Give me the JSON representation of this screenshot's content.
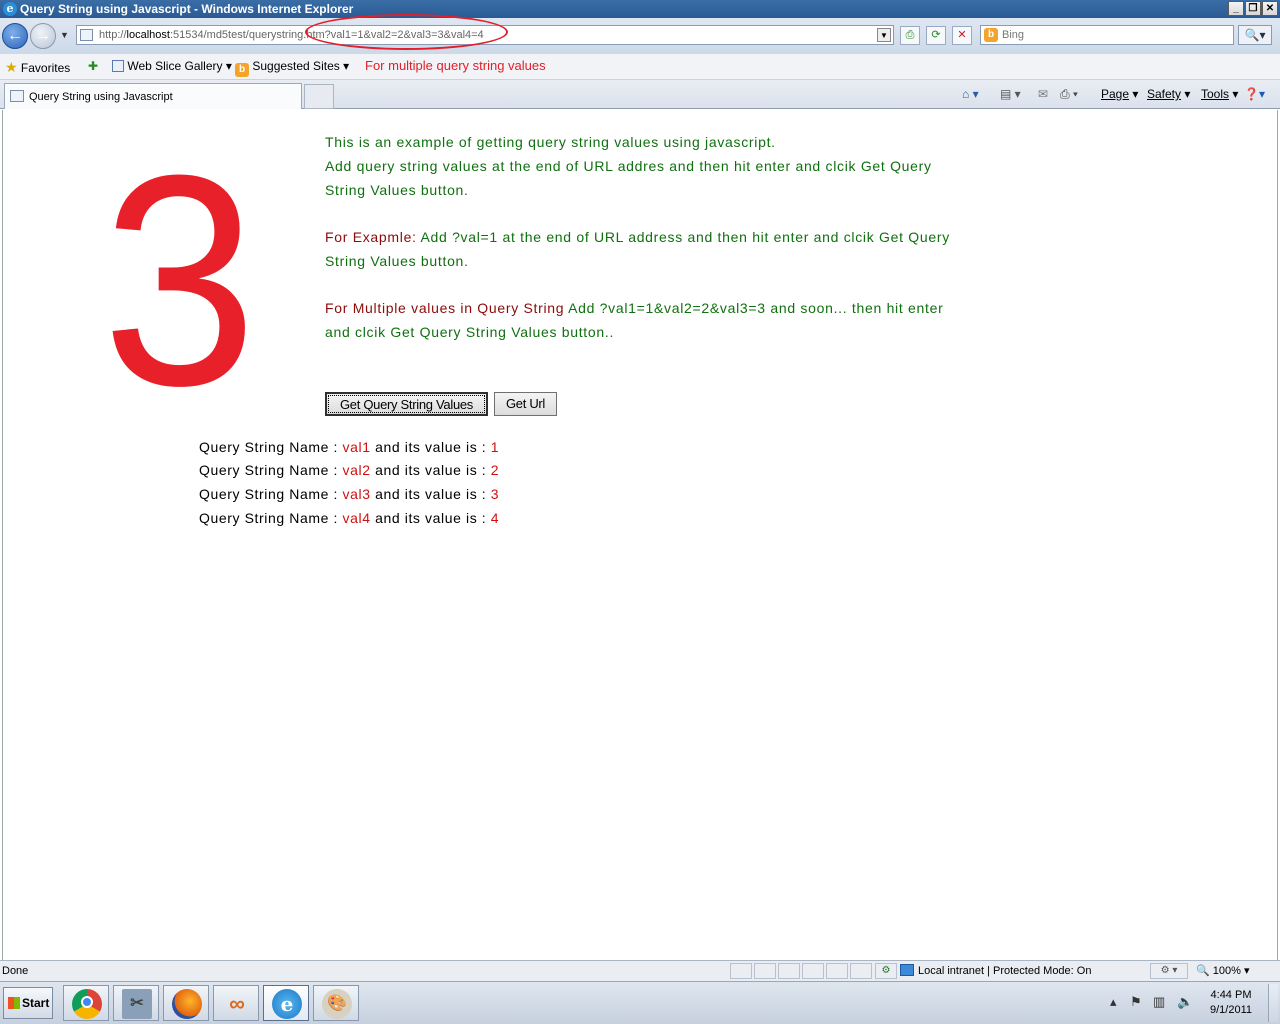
{
  "window": {
    "title": "Query String using Javascript - Windows Internet Explorer",
    "app_icon": "ie-icon"
  },
  "address_bar": {
    "url_prefix": "http://",
    "url_host": "localhost",
    "url_path": ":51534/md5test/querystring",
    "url_query": ".htm?val1=1&val2=2&val3=3&val4=4",
    "search_placeholder": "Bing"
  },
  "favorites_bar": {
    "favorites_label": "Favorites",
    "web_slice_gallery": "Web Slice Gallery ▾",
    "suggested_sites": "Suggested Sites ▾",
    "annotation": "For multiple query string values"
  },
  "tab_bar": {
    "active_tab": "Query String using Javascript",
    "commands": {
      "page": "Page",
      "safety": "Safety",
      "tools": "Tools"
    }
  },
  "content": {
    "big_number": "3",
    "intro_line1": "This is an example of getting query string values using javascript.",
    "intro_line2": "Add query string values at the end of URL addres and then hit enter and clcik Get Query String Values button.",
    "example_label": "For Exapmle:",
    "example_text": " Add ?val=1 at the end of URL address and then hit enter and clcik Get Query String Values button.",
    "multiple_label_a": "For Multiple values in ",
    "multiple_label_b": "Query String",
    "multiple_text": " Add ?val1=1&val2=2&val3=3 and soon... then hit enter and clcik Get Query String Values button..",
    "buttons": {
      "get_values": "Get Query String Values",
      "get_url": "Get Url"
    },
    "result_prefix": "Query String Name : ",
    "result_middle": " and its value is : ",
    "results": [
      {
        "name": "val1",
        "value": "1"
      },
      {
        "name": "val2",
        "value": "2"
      },
      {
        "name": "val3",
        "value": "3"
      },
      {
        "name": "val4",
        "value": "4"
      }
    ]
  },
  "status_bar": {
    "status_text": "Done",
    "zone_text": "Local intranet | Protected Mode: On",
    "zoom": "100%"
  },
  "taskbar": {
    "start_label": "Start",
    "apps": [
      "chrome-icon",
      "tools-icon",
      "firefox-icon",
      "visual-studio-icon",
      "internet-explorer-icon",
      "paint-icon"
    ],
    "time": "4:44 PM",
    "date": "9/1/2011"
  }
}
